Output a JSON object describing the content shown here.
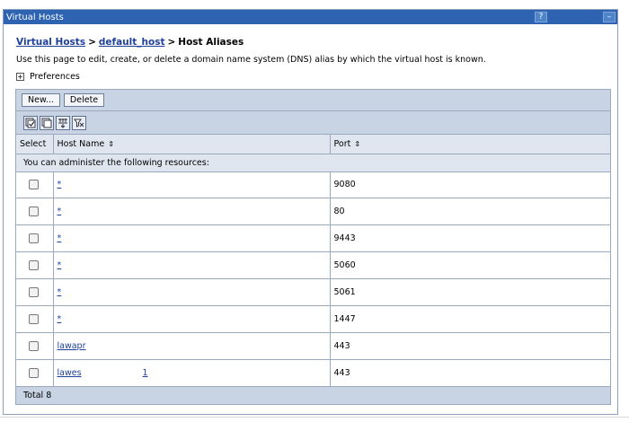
{
  "window": {
    "title": "Virtual Hosts",
    "help_glyph": "?",
    "minimize_glyph": "–"
  },
  "breadcrumb": {
    "items": [
      "Virtual Hosts",
      "default_host"
    ],
    "current": "Host Aliases",
    "separator": ">"
  },
  "description": "Use this page to edit, create, or delete a domain name system (DNS) alias by which the virtual host is known.",
  "preferences": {
    "toggle": "+",
    "label": "Preferences"
  },
  "toolbar": {
    "new_label": "New...",
    "delete_label": "Delete"
  },
  "icon_toolbar": [
    "select-all-icon",
    "deselect-all-icon",
    "show-filter-icon",
    "clear-filter-icon"
  ],
  "table": {
    "columns": {
      "select": "Select",
      "host": "Host Name",
      "port": "Port"
    },
    "sort_glyph": "⇕",
    "section_label": "You can administer the following resources:",
    "rows": [
      {
        "host": "*",
        "port": "9080"
      },
      {
        "host": "*",
        "port": "80"
      },
      {
        "host": "*",
        "port": "9443"
      },
      {
        "host": "*",
        "port": "5060"
      },
      {
        "host": "*",
        "port": "5061"
      },
      {
        "host": "*",
        "port": "1447"
      },
      {
        "host": "lawapr",
        "port": "443",
        "trail": ""
      },
      {
        "host": "lawes",
        "port": "443",
        "trail": "1"
      }
    ],
    "total": "Total 8"
  },
  "colors": {
    "titlebar": "#2e63b1",
    "toolbar_bg": "#c8d3e3",
    "header_bg": "#dfe6f0",
    "link": "#1f3f9a",
    "border": "#9aa9bd"
  }
}
